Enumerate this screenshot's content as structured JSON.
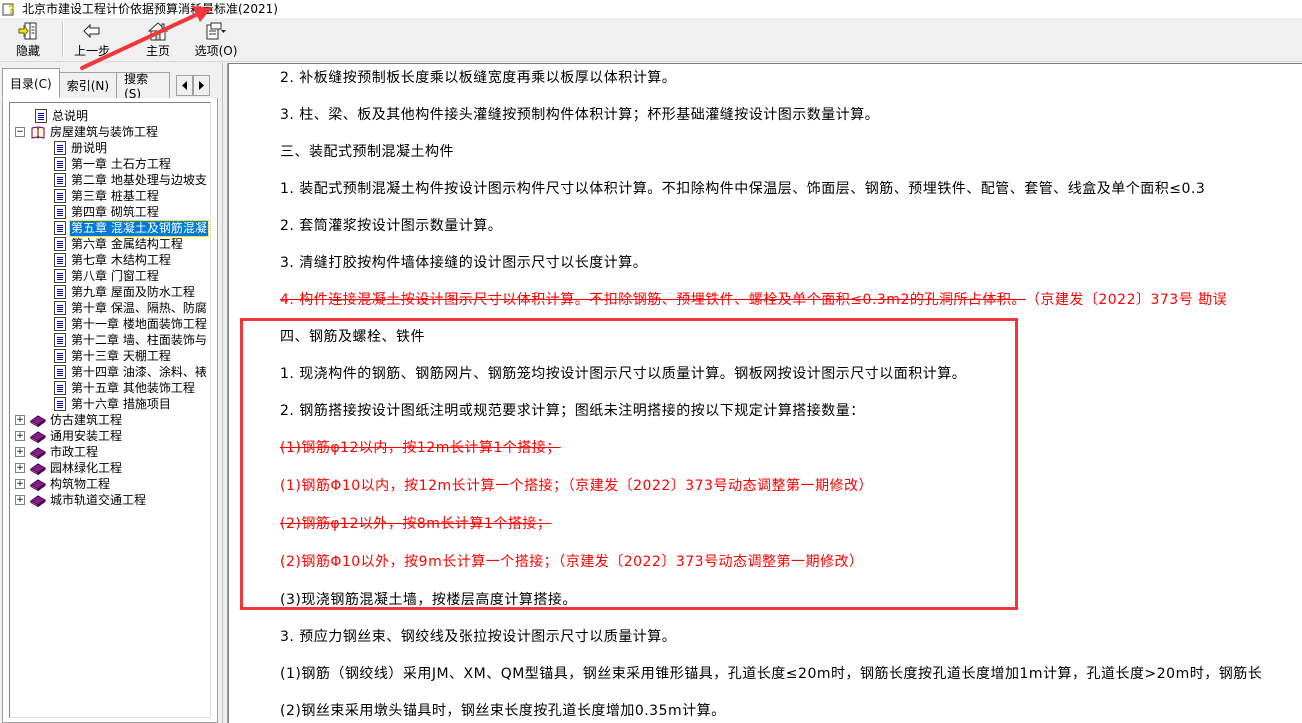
{
  "window": {
    "title": "北京市建设工程计价依据预算消耗量标准(2021)"
  },
  "toolbar": {
    "buttons": [
      {
        "id": "hide",
        "label": "隐藏",
        "icon": "hide-pane-icon"
      },
      {
        "id": "back",
        "label": "上一步",
        "icon": "back-arrow-icon"
      },
      {
        "id": "home",
        "label": "主页",
        "icon": "home-icon"
      },
      {
        "id": "options",
        "label": "选项(O)",
        "icon": "options-icon"
      }
    ]
  },
  "nav": {
    "tabs": [
      {
        "label": "目录(C)",
        "active": true
      },
      {
        "label": "索引(N)",
        "active": false
      },
      {
        "label": "搜索(S)",
        "active": false
      }
    ],
    "tree": [
      {
        "label": "总说明",
        "level": 1,
        "icon": "page",
        "expander": null
      },
      {
        "label": "房屋建筑与装饰工程",
        "level": 0,
        "icon": "open-book",
        "expander": "-"
      },
      {
        "label": "册说明",
        "level": 2,
        "icon": "page",
        "expander": null
      },
      {
        "label": "第一章  土石方工程",
        "level": 2,
        "icon": "page",
        "expander": null
      },
      {
        "label": "第二章  地基处理与边坡支",
        "level": 2,
        "icon": "page",
        "expander": null
      },
      {
        "label": "第三章  桩基工程",
        "level": 2,
        "icon": "page",
        "expander": null
      },
      {
        "label": "第四章  砌筑工程",
        "level": 2,
        "icon": "page",
        "expander": null
      },
      {
        "label": "第五章  混凝土及钢筋混凝",
        "level": 2,
        "icon": "page",
        "expander": null,
        "selected": true
      },
      {
        "label": "第六章  金属结构工程",
        "level": 2,
        "icon": "page",
        "expander": null
      },
      {
        "label": "第七章  木结构工程",
        "level": 2,
        "icon": "page",
        "expander": null
      },
      {
        "label": "第八章  门窗工程",
        "level": 2,
        "icon": "page",
        "expander": null
      },
      {
        "label": "第九章  屋面及防水工程",
        "level": 2,
        "icon": "page",
        "expander": null
      },
      {
        "label": "第十章  保温、隔热、防腐",
        "level": 2,
        "icon": "page",
        "expander": null
      },
      {
        "label": "第十一章  楼地面装饰工程",
        "level": 2,
        "icon": "page",
        "expander": null
      },
      {
        "label": "第十二章  墙、柱面装饰与",
        "level": 2,
        "icon": "page",
        "expander": null
      },
      {
        "label": "第十三章  天棚工程",
        "level": 2,
        "icon": "page",
        "expander": null
      },
      {
        "label": "第十四章  油漆、涂料、裱",
        "level": 2,
        "icon": "page",
        "expander": null
      },
      {
        "label": "第十五章  其他装饰工程",
        "level": 2,
        "icon": "page",
        "expander": null
      },
      {
        "label": "第十六章  措施项目",
        "level": 2,
        "icon": "page",
        "expander": null
      },
      {
        "label": "仿古建筑工程",
        "level": 0,
        "icon": "book",
        "expander": "+"
      },
      {
        "label": "通用安装工程",
        "level": 0,
        "icon": "book",
        "expander": "+"
      },
      {
        "label": "市政工程",
        "level": 0,
        "icon": "book",
        "expander": "+"
      },
      {
        "label": "园林绿化工程",
        "level": 0,
        "icon": "book",
        "expander": "+"
      },
      {
        "label": "构筑物工程",
        "level": 0,
        "icon": "book",
        "expander": "+"
      },
      {
        "label": "城市轨道交通工程",
        "level": 0,
        "icon": "book",
        "expander": "+"
      }
    ]
  },
  "content": {
    "paragraphs": [
      {
        "text": "2. 补板缝按预制板长度乘以板缝宽度再乘以板厚以体积计算。",
        "style": "normal"
      },
      {
        "text": "3. 柱、梁、板及其他构件接头灌缝按预制构件体积计算；杯形基础灌缝按设计图示数量计算。",
        "style": "normal"
      },
      {
        "text": "三、装配式预制混凝土构件",
        "style": "normal"
      },
      {
        "text": "1. 装配式预制混凝土构件按设计图示构件尺寸以体积计算。不扣除构件中保温层、饰面层、钢筋、预埋铁件、配管、套管、线盒及单个面积≤0.3",
        "style": "normal"
      },
      {
        "text": "2. 套筒灌浆按设计图示数量计算。",
        "style": "normal"
      },
      {
        "text": "3. 清缝打胶按构件墙体接缝的设计图示尺寸以长度计算。",
        "style": "normal"
      },
      {
        "text": "4. 构件连接混凝土按设计图示尺寸以体积计算。不扣除钢筋、预埋铁件、螺栓及单个面积≤0.3m2的孔洞所占体积。",
        "style": "red-strike",
        "suffix": "（京建发〔2022〕373号 勘误"
      },
      {
        "text": "四、钢筋及螺栓、铁件",
        "style": "normal"
      },
      {
        "text": "1. 现浇构件的钢筋、钢筋网片、钢筋笼均按设计图示尺寸以质量计算。钢板网按设计图示尺寸以面积计算。",
        "style": "normal"
      },
      {
        "text": "2. 钢筋搭接按设计图纸注明或规范要求计算；图纸未注明搭接的按以下规定计算搭接数量：",
        "style": "normal"
      },
      {
        "text": "(1)钢筋φ12以内，按12m长计算1个搭接；",
        "style": "red-strike"
      },
      {
        "text": "(1)钢筋Φ10以内，按12m长计算一个搭接；（京建发〔2022〕373号动态调整第一期修改）",
        "style": "red"
      },
      {
        "text": "(2)钢筋φ12以外，按8m长计算1个搭接；",
        "style": "red-strike"
      },
      {
        "text": "(2)钢筋Φ10以外，按9m长计算一个搭接；（京建发〔2022〕373号动态调整第一期修改）",
        "style": "red"
      },
      {
        "text": "(3)现浇钢筋混凝土墙，按楼层高度计算搭接。",
        "style": "normal"
      },
      {
        "text": "3. 预应力钢丝束、钢绞线及张拉按设计图示尺寸以质量计算。",
        "style": "normal"
      },
      {
        "text": "(1)钢筋（钢绞线）采用JM、XM、QM型锚具，钢丝束采用锥形锚具，孔道长度≤20m时，钢筋长度按孔道长度增加1m计算，孔道长度>20m时，钢筋长",
        "style": "normal"
      },
      {
        "text": "(2)钢丝束采用墩头锚具时，钢丝束长度按孔道长度增加0.35m计算。",
        "style": "normal"
      }
    ]
  },
  "annotations": {
    "highlight_color": "#f0383c",
    "arrow_color": "#f0383c"
  }
}
